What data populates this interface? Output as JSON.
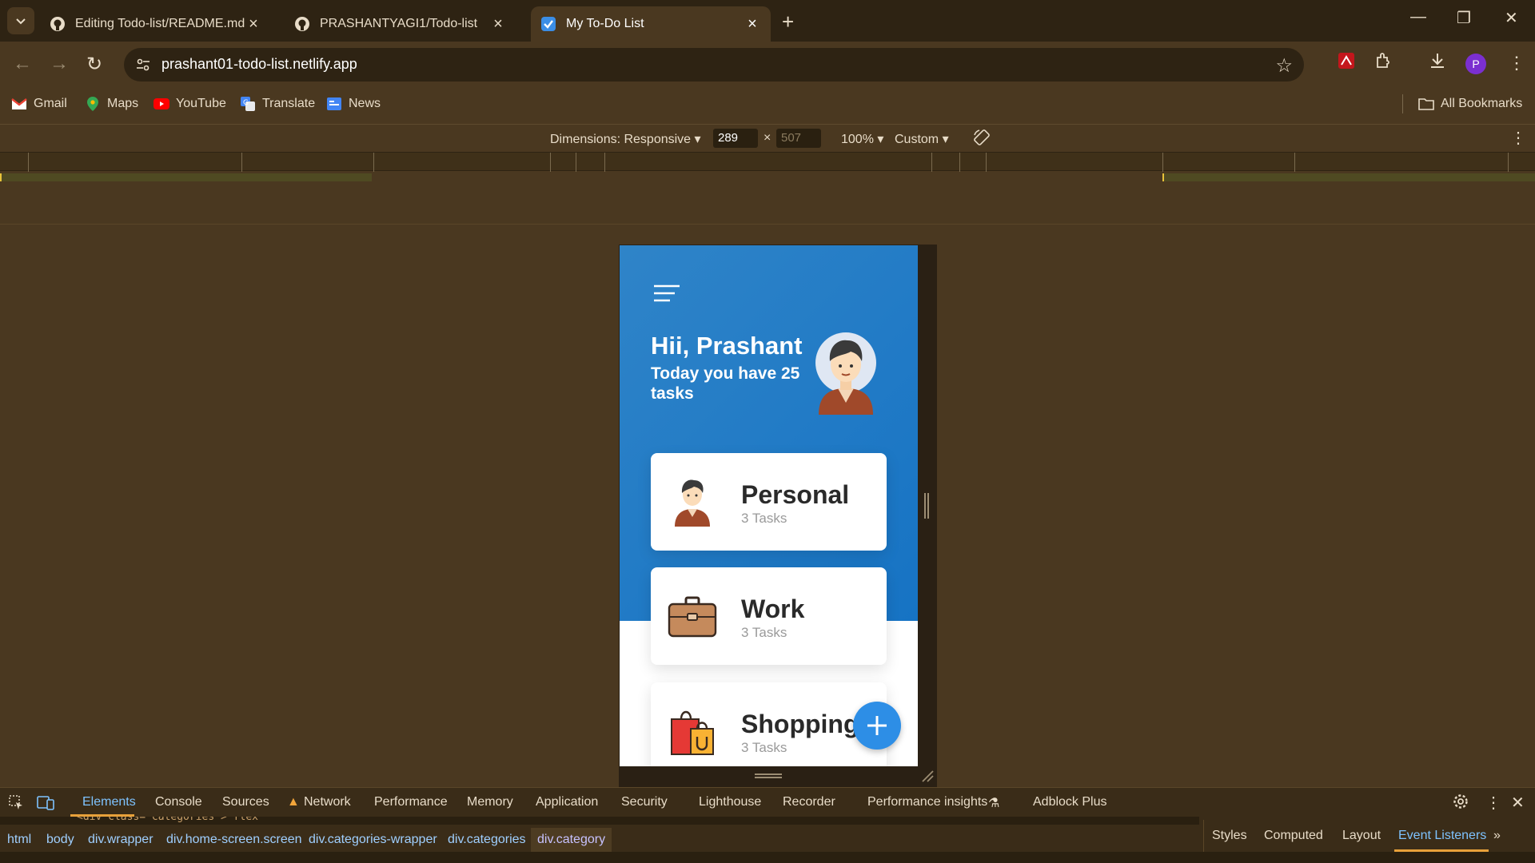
{
  "browser": {
    "tabs": [
      {
        "title": "Editing Todo-list/README.md a",
        "active": false,
        "icon": "github-icon"
      },
      {
        "title": "PRASHANTYAGI1/Todo-list",
        "active": false,
        "icon": "github-icon"
      },
      {
        "title": "My To-Do List",
        "active": true,
        "icon": "checkbox-icon"
      }
    ],
    "url": "prashant01-todo-list.netlify.app",
    "profile_initial": "P",
    "bookmarks": [
      {
        "label": "Gmail",
        "icon": "gmail-icon"
      },
      {
        "label": "Maps",
        "icon": "maps-icon"
      },
      {
        "label": "YouTube",
        "icon": "youtube-icon"
      },
      {
        "label": "Translate",
        "icon": "translate-icon"
      },
      {
        "label": "News",
        "icon": "news-icon"
      }
    ],
    "all_bookmarks": "All Bookmarks"
  },
  "device_toolbar": {
    "dimensions_label": "Dimensions: Responsive",
    "width": "289",
    "height": "507",
    "zoom": "100%",
    "throttle": "Custom"
  },
  "app": {
    "greeting": "Hii, Prashant",
    "subtitle": "Today you have 25 tasks",
    "categories": [
      {
        "name": "Personal",
        "count": "3 Tasks",
        "icon": "person-icon"
      },
      {
        "name": "Work",
        "count": "3 Tasks",
        "icon": "briefcase-icon"
      },
      {
        "name": "Shopping",
        "count": "3 Tasks",
        "icon": "shopping-bag-icon"
      }
    ],
    "colors": {
      "primary": "#1673c4",
      "fab": "#2d8ee6"
    }
  },
  "devtools": {
    "tabs": [
      "Elements",
      "Console",
      "Sources",
      "Network",
      "Performance",
      "Memory",
      "Application",
      "Security",
      "Lighthouse",
      "Recorder",
      "Performance insights",
      "Adblock Plus"
    ],
    "active_tab": "Elements",
    "code_snippet": "<div class=\"categories\"> flex",
    "breadcrumbs": [
      "html",
      "body",
      "div.wrapper",
      "div.home-screen.screen",
      "div.categories-wrapper",
      "div.categories",
      "div.category"
    ],
    "side_tabs": [
      "Styles",
      "Computed",
      "Layout",
      "Event Listeners"
    ],
    "active_side_tab": "Event Listeners"
  }
}
